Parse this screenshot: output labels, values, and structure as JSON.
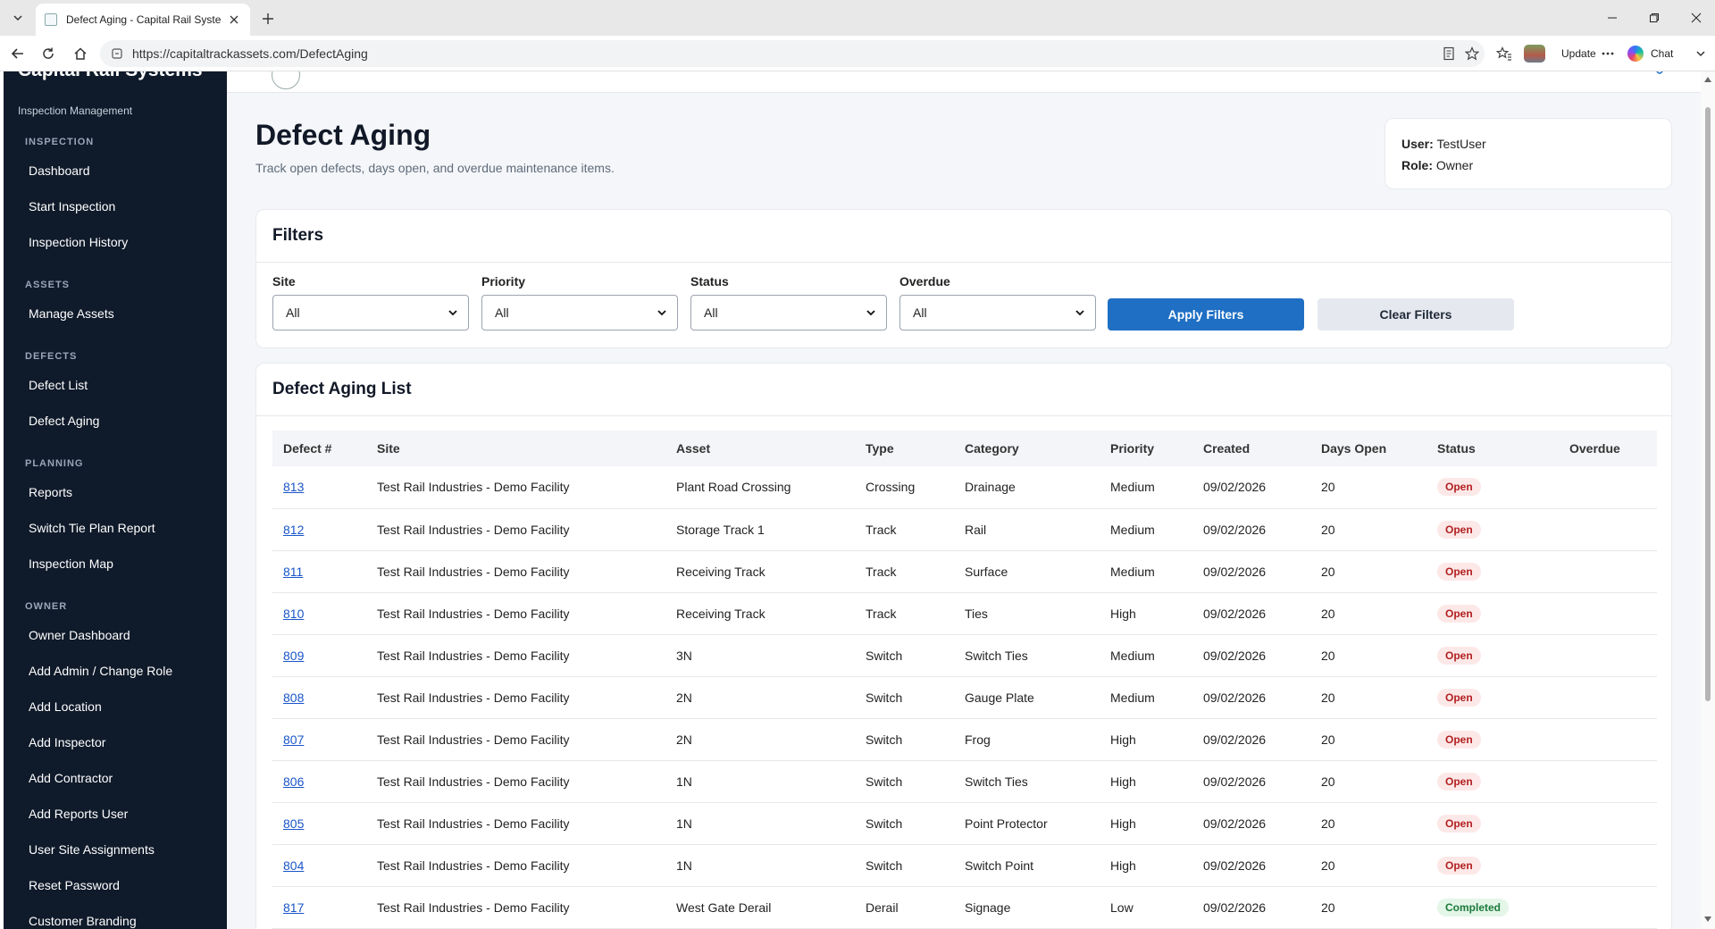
{
  "browser": {
    "tab_title": "Defect Aging - Capital Rail Systems",
    "url": "https://capitaltrackassets.com/DefectAging",
    "update_label": "Update",
    "chat_label": "Chat"
  },
  "sidebar": {
    "brand_name": "Capital Rail Systems",
    "brand_subtitle": "Inspection Management",
    "sections": [
      {
        "title": "INSPECTION",
        "items": [
          "Dashboard",
          "Start Inspection",
          "Inspection History"
        ]
      },
      {
        "title": "ASSETS",
        "items": [
          "Manage Assets"
        ]
      },
      {
        "title": "DEFECTS",
        "items": [
          "Defect List",
          "Defect Aging"
        ]
      },
      {
        "title": "PLANNING",
        "items": [
          "Reports",
          "Switch Tie Plan Report",
          "Inspection Map"
        ]
      },
      {
        "title": "OWNER",
        "items": [
          "Owner Dashboard",
          "Add Admin / Change Role",
          "Add Location",
          "Add Inspector",
          "Add Contractor",
          "Add Reports User",
          "User Site Assignments",
          "Reset Password",
          "Customer Branding"
        ]
      }
    ]
  },
  "page": {
    "title": "Defect Aging",
    "subtitle": "Track open defects, days open, and overdue maintenance items."
  },
  "user_card": {
    "user_label": "User:",
    "user_value": "TestUser",
    "role_label": "Role:",
    "role_value": "Owner"
  },
  "filters": {
    "title": "Filters",
    "site_label": "Site",
    "site_value": "All",
    "priority_label": "Priority",
    "priority_value": "All",
    "status_label": "Status",
    "status_value": "All",
    "overdue_label": "Overdue",
    "overdue_value": "All",
    "apply_label": "Apply Filters",
    "clear_label": "Clear Filters"
  },
  "defect_list": {
    "title": "Defect Aging List",
    "columns": [
      "Defect #",
      "Site",
      "Asset",
      "Type",
      "Category",
      "Priority",
      "Created",
      "Days Open",
      "Status",
      "Overdue"
    ],
    "rows": [
      {
        "id": "813",
        "site": "Test Rail Industries - Demo Facility",
        "asset": "Plant Road Crossing",
        "type": "Crossing",
        "category": "Drainage",
        "priority": "Medium",
        "created": "09/02/2026",
        "days_open": "20",
        "status": "Open",
        "overdue": ""
      },
      {
        "id": "812",
        "site": "Test Rail Industries - Demo Facility",
        "asset": "Storage Track 1",
        "type": "Track",
        "category": "Rail",
        "priority": "Medium",
        "created": "09/02/2026",
        "days_open": "20",
        "status": "Open",
        "overdue": ""
      },
      {
        "id": "811",
        "site": "Test Rail Industries - Demo Facility",
        "asset": "Receiving Track",
        "type": "Track",
        "category": "Surface",
        "priority": "Medium",
        "created": "09/02/2026",
        "days_open": "20",
        "status": "Open",
        "overdue": ""
      },
      {
        "id": "810",
        "site": "Test Rail Industries - Demo Facility",
        "asset": "Receiving Track",
        "type": "Track",
        "category": "Ties",
        "priority": "High",
        "created": "09/02/2026",
        "days_open": "20",
        "status": "Open",
        "overdue": ""
      },
      {
        "id": "809",
        "site": "Test Rail Industries - Demo Facility",
        "asset": "3N",
        "type": "Switch",
        "category": "Switch Ties",
        "priority": "Medium",
        "created": "09/02/2026",
        "days_open": "20",
        "status": "Open",
        "overdue": ""
      },
      {
        "id": "808",
        "site": "Test Rail Industries - Demo Facility",
        "asset": "2N",
        "type": "Switch",
        "category": "Gauge Plate",
        "priority": "Medium",
        "created": "09/02/2026",
        "days_open": "20",
        "status": "Open",
        "overdue": ""
      },
      {
        "id": "807",
        "site": "Test Rail Industries - Demo Facility",
        "asset": "2N",
        "type": "Switch",
        "category": "Frog",
        "priority": "High",
        "created": "09/02/2026",
        "days_open": "20",
        "status": "Open",
        "overdue": ""
      },
      {
        "id": "806",
        "site": "Test Rail Industries - Demo Facility",
        "asset": "1N",
        "type": "Switch",
        "category": "Switch Ties",
        "priority": "High",
        "created": "09/02/2026",
        "days_open": "20",
        "status": "Open",
        "overdue": ""
      },
      {
        "id": "805",
        "site": "Test Rail Industries - Demo Facility",
        "asset": "1N",
        "type": "Switch",
        "category": "Point Protector",
        "priority": "High",
        "created": "09/02/2026",
        "days_open": "20",
        "status": "Open",
        "overdue": ""
      },
      {
        "id": "804",
        "site": "Test Rail Industries - Demo Facility",
        "asset": "1N",
        "type": "Switch",
        "category": "Switch Point",
        "priority": "High",
        "created": "09/02/2026",
        "days_open": "20",
        "status": "Open",
        "overdue": ""
      },
      {
        "id": "817",
        "site": "Test Rail Industries - Demo Facility",
        "asset": "West Gate Derail",
        "type": "Derail",
        "category": "Signage",
        "priority": "Low",
        "created": "09/02/2026",
        "days_open": "20",
        "status": "Completed",
        "overdue": ""
      }
    ]
  },
  "colors": {
    "sidebar_bg": "#0f1a2a",
    "primary": "#1f6fc4",
    "open_badge": "#b21f1f",
    "completed_badge": "#1b7a3a"
  },
  "icons": {
    "back": "back-arrow-icon",
    "refresh": "refresh-icon",
    "home": "home-icon",
    "site_info": "site-info-icon",
    "favorite": "star-icon"
  }
}
